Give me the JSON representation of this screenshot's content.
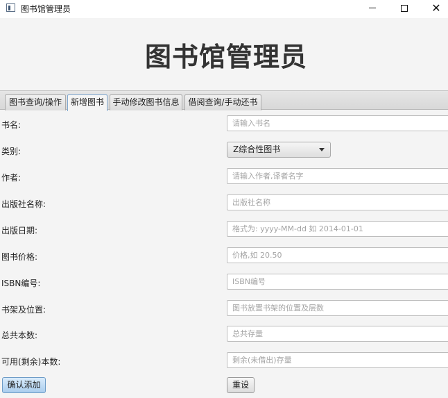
{
  "window": {
    "title": "图书馆管理员",
    "controls": {
      "minimize": "",
      "maximize": "",
      "close": "✕"
    }
  },
  "header": {
    "title": "图书馆管理员"
  },
  "tabs": [
    {
      "label": "图书查询/操作",
      "active": false
    },
    {
      "label": "新增图书",
      "active": true
    },
    {
      "label": "手动修改图书信息",
      "active": false
    },
    {
      "label": "借阅查询/手动还书",
      "active": false
    }
  ],
  "form": {
    "title_label": "书名:",
    "title_placeholder": "请输入书名",
    "category_label": "类别:",
    "category_value": "Z综合性图书",
    "author_label": "作者:",
    "author_placeholder": "请输入作者,译者名字",
    "publisher_label": "出版社名称:",
    "publisher_placeholder": "出版社名称",
    "date_label": "出版日期:",
    "date_placeholder": "格式为: yyyy-MM-dd 如 2014-01-01",
    "price_label": "图书价格:",
    "price_placeholder": "价格,如 20.50",
    "isbn_label": "ISBN编号:",
    "isbn_placeholder": "ISBN编号",
    "shelf_label": "书架及位置:",
    "shelf_placeholder": "图书放置书架的位置及层数",
    "total_label": "总共本数:",
    "total_placeholder": "总共存量",
    "available_label": "可用(剩余)本数:",
    "available_placeholder": "剩余(未借出)存量"
  },
  "buttons": {
    "confirm": "确认添加",
    "reset": "重设"
  }
}
